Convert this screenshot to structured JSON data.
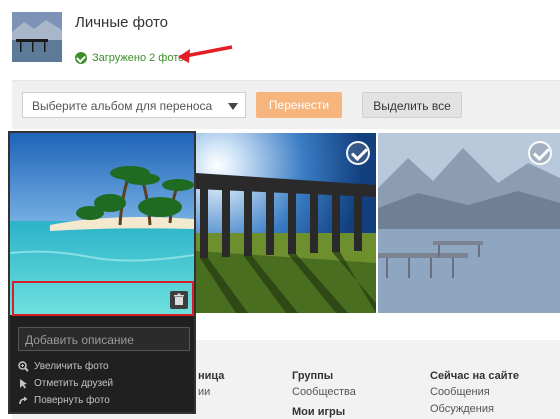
{
  "album": {
    "title": "Личные фото",
    "upload_status": "Загружено 2 фото"
  },
  "toolbar": {
    "album_select_placeholder": "Выберите альбом для переноса",
    "move_button": "Перенести",
    "select_all_button": "Выделить все"
  },
  "card": {
    "description_placeholder": "Добавить описание",
    "actions": [
      "Увеличить фото",
      "Отметить друзей",
      "Повернуть фото"
    ]
  },
  "footer": {
    "col1": {
      "partial": "ница",
      "partial2": "ии"
    },
    "col2": {
      "heading": "Группы",
      "link": "Сообщества",
      "heading2": "Мои игры"
    },
    "col3": {
      "heading": "Сейчас на сайте",
      "links": [
        "Сообщения",
        "Обсуждения"
      ]
    }
  },
  "colors": {
    "status_green": "#3d8f2b",
    "move_button": "#f5b57c",
    "highlight_red": "#d61f26"
  }
}
